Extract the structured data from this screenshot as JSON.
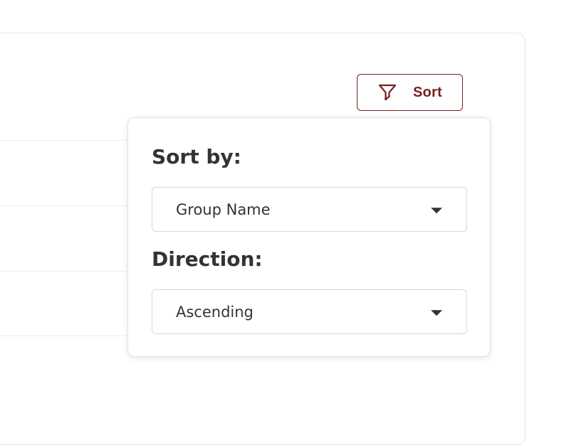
{
  "toolbar": {
    "sort_label": "Sort",
    "accent_color": "#7a1f1f"
  },
  "sort_popover": {
    "sort_by_label": "Sort by:",
    "sort_by_value": "Group Name",
    "direction_label": "Direction:",
    "direction_value": "Ascending"
  },
  "icons": {
    "sort_button_icon": "filter-funnel-icon",
    "select_caret_icon": "caret-down-icon"
  }
}
